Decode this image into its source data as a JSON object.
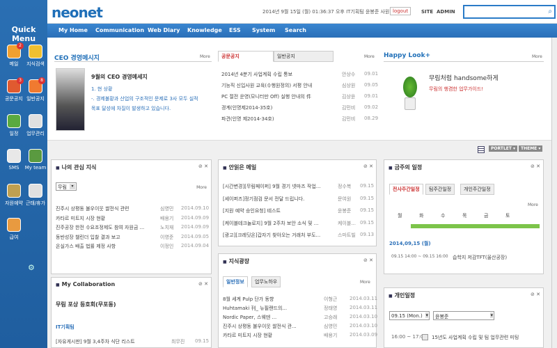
{
  "quick_menu": {
    "title": "Quick Menu",
    "items": [
      {
        "label": "메일",
        "badge": "2",
        "icon": "mail-icon",
        "color": "#f0a030"
      },
      {
        "label": "지식검색",
        "badge": "",
        "icon": "lightbulb-icon",
        "color": "#f0c030"
      },
      {
        "label": "공문공지",
        "badge": "3",
        "icon": "notice-icon",
        "color": "#e05a30"
      },
      {
        "label": "일반공지",
        "badge": "8",
        "icon": "memo-icon",
        "color": "#f07a30"
      },
      {
        "label": "일정",
        "badge": "",
        "icon": "calendar-icon",
        "color": "#5aaa40"
      },
      {
        "label": "업무관리",
        "badge": "",
        "icon": "checklist-icon",
        "color": "#e0e0e0"
      },
      {
        "label": "SMS",
        "badge": "",
        "icon": "phone-icon",
        "color": "#e8e8e8"
      },
      {
        "label": "My team",
        "badge": "",
        "icon": "team-icon",
        "color": "#5a9a40"
      },
      {
        "label": "자원예약",
        "badge": "",
        "icon": "resource-icon",
        "color": "#c0a050"
      },
      {
        "label": "근태/휴가",
        "badge": "",
        "icon": "attendance-icon",
        "color": "#e0e0e0"
      },
      {
        "label": "급여",
        "badge": "",
        "icon": "person-icon",
        "color": "#e89a40"
      }
    ]
  },
  "header": {
    "logo": "neonet",
    "info": "2014년 9월 15일 (월) 01:36:37 오후  IT기획팀  윤봉준 사원",
    "logout": "logout",
    "site": "SITE",
    "admin": "ADMIN",
    "search_placeholder": ""
  },
  "nav": [
    "My Home",
    "Communication",
    "Web Diary",
    "Knowledge",
    "ESS",
    "System",
    "Search"
  ],
  "ceo": {
    "title": "CEO 경영메시지",
    "more": "More",
    "heading": "9월의 CEO 경영메세지",
    "line1": "1. 현 상황",
    "line2": "-. 경제불황과 산업의 구조적인 문제로 3사 모두 실적",
    "line3": "목표 달성에 차질이 발생하고 있습니다."
  },
  "notice": {
    "tabs": [
      "공문공지",
      "일반공지"
    ],
    "more": "More",
    "rows": [
      {
        "t": "2014년 4분기 사업계획 수립 통보",
        "n": "안상수",
        "d": "09.01"
      },
      {
        "t": "기능직 신입사원 교육(수행원정의) 서평 안내",
        "n": "심상원",
        "d": "09.05"
      },
      {
        "t": "PC 절전 운영(모니터만 Off) 실행 안내의 件",
        "n": "김상윤",
        "d": "09.01"
      },
      {
        "t": "경계(인명제2014-35호)",
        "n": "김민비",
        "d": "09.02"
      },
      {
        "t": "파견(인명 제2014-34호)",
        "n": "김민비",
        "d": "08.29"
      }
    ]
  },
  "happy": {
    "title": "Happy Look+",
    "more": "More",
    "line1": "무림처럼 handsome하게",
    "line2": "무림의 행겸한 업무가이드!"
  },
  "toolbar": {
    "portlet": "PORTLET ▾",
    "theme": "THEME ▾"
  },
  "interest": {
    "title": "나의 관심 지식",
    "select": "무림",
    "more": "More",
    "rows": [
      {
        "t": "진주시 상평동 불우이웃 쌀전식 관련",
        "n": "심영민",
        "d": "2014.09.10"
      },
      {
        "t": "카타르 미트지 시장 현황",
        "n": "배용기",
        "d": "2014.09.09"
      },
      {
        "t": "진주공장 한전 수요조정제도 참여 자원금 ...",
        "n": "노치재",
        "d": "2014.09.09"
      },
      {
        "t": "동반성장 챌린더 입찰 결과 보고",
        "n": "이영준",
        "d": "2014.09.05"
      },
      {
        "t": "온실가스 배출 법률 제정 사항",
        "n": "이정인",
        "d": "2014.09.04"
      }
    ]
  },
  "unread": {
    "title": "안읽은 메일",
    "rows": [
      {
        "t": "[시간변경][무림페이퍼] 9월 경기 넷마즈 작업...",
        "n": "정수복",
        "d": "09.15"
      },
      {
        "t": "[세이퍼즈]정기점검 문서 전달 드립니다.",
        "n": "문여원",
        "d": "09.15"
      },
      {
        "t": "[지원 예약 승인요청] 테스트",
        "n": "윤봉준",
        "d": "09.15"
      },
      {
        "t": "[케이블테크놀로지] 9월 2주차 보안 소식 및 ...",
        "n": "케이블...",
        "d": "09.15"
      },
      {
        "t": "[광고][크레딧온]갑자기 찾아오는 거래처 부도...",
        "n": "스마트빌",
        "d": "09.13"
      }
    ]
  },
  "schedule": {
    "title": "금주의 일정",
    "tabs": [
      "전사주간일정",
      "팀주간일정",
      "개인주간일정"
    ],
    "more": "More",
    "days": [
      "월",
      "화",
      "수",
      "목",
      "금",
      "토"
    ],
    "date": "2014,09,15 (월)",
    "item_time": "09.15 14:00 ~ 09.15 16:00",
    "item": "습학지 저감TFT(울산공장)"
  },
  "collab": {
    "title": "My Collaboration",
    "item1": "무림 포상 등호회(무포동)",
    "item2": "IT기획팀",
    "row": "[자유게시판] 9월 3,4주차 식단 리스트",
    "n": "최무진",
    "d": "09.15"
  },
  "knowledge": {
    "title": "지식광장",
    "tabs": [
      "일반정보",
      "업무노하우"
    ],
    "more": "More",
    "rows": [
      {
        "t": "8월 세계 Pulp 단가 동향",
        "n": "이형근",
        "d": "2014.03.11"
      },
      {
        "t": "Huhtamaki 刊_ 뉴필랜드의...",
        "n": "정태영",
        "d": "2014.03.11"
      },
      {
        "t": "Nordic Paper, 스웨덴 ...",
        "n": "고승래",
        "d": "2014.03.10"
      },
      {
        "t": "진주시 상평동 불우이웃 쌀전식 관...",
        "n": "심영민",
        "d": "2014.03.10"
      },
      {
        "t": "카타르 미트지 시장 현황",
        "n": "배용기",
        "d": "2014.03.09"
      }
    ]
  },
  "personal": {
    "title": "개인일정",
    "date_select": "09.15 (Mon.)",
    "user_select": "윤봉준",
    "time": "16:00 ~ 17:00",
    "text": "15년도 사업계획 수립 및 팀 업무관련 미팅"
  }
}
